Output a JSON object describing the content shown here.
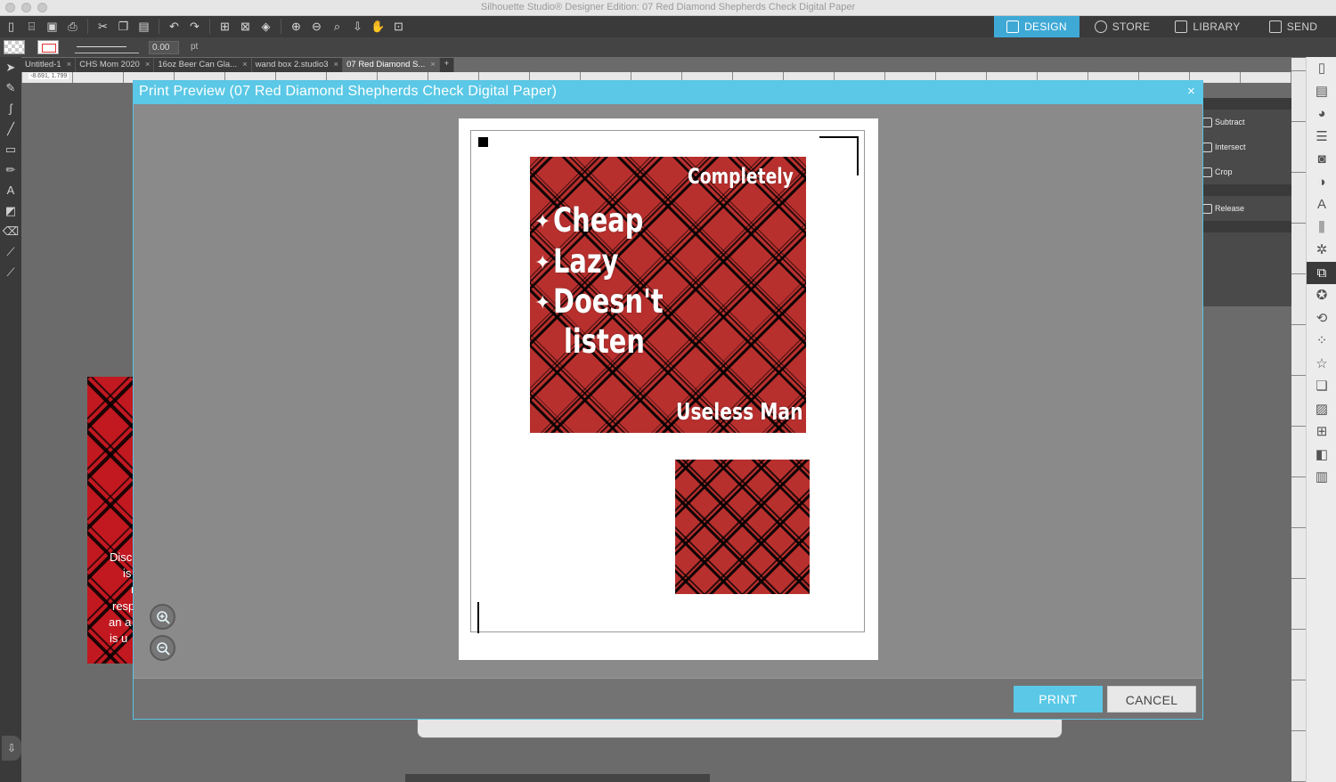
{
  "window": {
    "title": "Silhouette Studio® Designer Edition: 07 Red Diamond Shepherds Check Digital Paper"
  },
  "nav_tabs": [
    {
      "label": "DESIGN",
      "active": true
    },
    {
      "label": "STORE",
      "active": false
    },
    {
      "label": "LIBRARY",
      "active": false
    },
    {
      "label": "SEND",
      "active": false
    }
  ],
  "line_weight": {
    "value": "0.00",
    "unit": "pt"
  },
  "doc_tabs": [
    {
      "label": "Untitled-1",
      "active": false
    },
    {
      "label": "CHS Mom 2020",
      "active": false
    },
    {
      "label": "16oz Beer Can Gla...",
      "active": false
    },
    {
      "label": "wand box 2.studio3",
      "active": false
    },
    {
      "label": "07 Red Diamond S...",
      "active": true
    }
  ],
  "ruler": {
    "coords": "-8.691, 1.799"
  },
  "right_panel": {
    "items": [
      "Subtract",
      "Intersect",
      "Crop",
      "Release"
    ]
  },
  "canvas_text": {
    "lines": [
      "Disc",
      "is",
      "r",
      "resp",
      "an a",
      "is u"
    ]
  },
  "dialog": {
    "title": "Print Preview (07 Red Diamond Shepherds Check Digital Paper)",
    "close_label": "×",
    "print_label": "PRINT",
    "cancel_label": "CANCEL"
  },
  "design": {
    "heading": "Completely",
    "items": [
      "Cheap",
      "Lazy",
      "Doesn't",
      "listen"
    ],
    "footer": "Useless Man"
  },
  "colors": {
    "accent": "#5ac8e6",
    "plaid_red": "#b8302e",
    "plaid_black": "#000000"
  }
}
